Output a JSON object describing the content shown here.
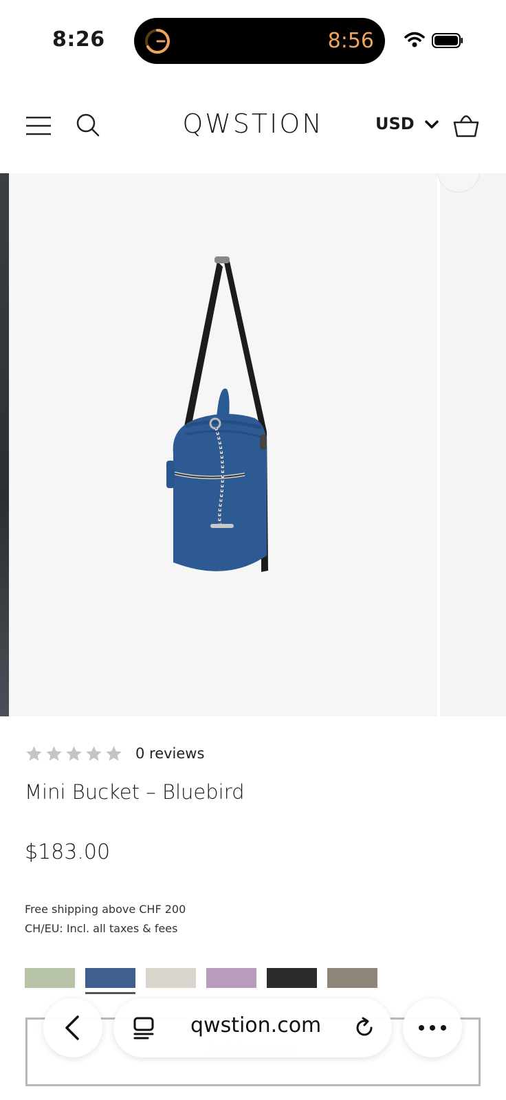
{
  "status_bar": {
    "time": "8:26",
    "island_time": "8:56"
  },
  "header": {
    "brand": "QWSTION",
    "currency": "USD"
  },
  "product": {
    "reviews": "0 reviews",
    "rating": 0,
    "title": "Mini Bucket – Bluebird",
    "price": "$183.00",
    "shipping_line_1": "Free shipping above CHF 200",
    "shipping_line_2": "CH/EU: Incl. all taxes & fees",
    "swatches": [
      {
        "color": "#b8c4a8"
      },
      {
        "color": "#3f5f8c",
        "selected": true
      },
      {
        "color": "#d8d6cc"
      },
      {
        "color": "#b79cbc"
      },
      {
        "color": "#2b2b2b"
      },
      {
        "color": "#8c8578"
      }
    ],
    "add_to_cart": "Add to cart"
  },
  "browser": {
    "url": "qwstion.com"
  },
  "colors": {
    "accent_orange": "#f0a35a",
    "bag_blue": "#2d5a92"
  }
}
